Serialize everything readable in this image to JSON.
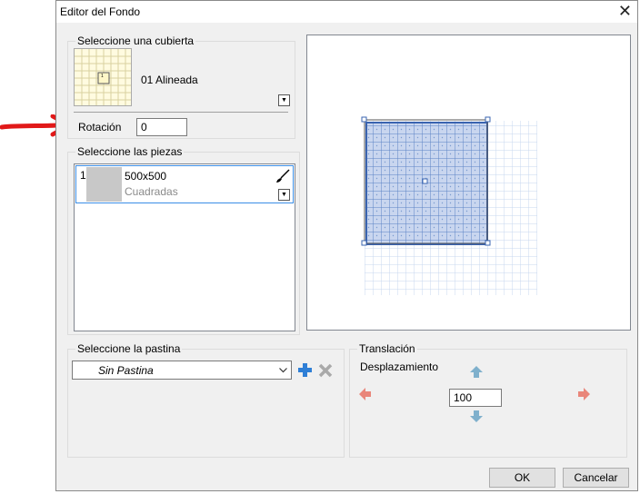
{
  "window": {
    "title": "Editor del Fondo",
    "close_glyph": "✕"
  },
  "cubierta": {
    "group_label": "Seleccione una cubierta",
    "selected_name": "01 Alineada",
    "thumb_marker": "1",
    "rotation_label": "Rotación",
    "rotation_value": "0"
  },
  "piezas": {
    "group_label": "Seleccione las piezas",
    "items": [
      {
        "index": "1",
        "size": "500x500",
        "type": "Cuadradas"
      }
    ]
  },
  "pastina": {
    "group_label": "Seleccione la pastina",
    "selected": "Sin Pastina",
    "add_icon": "plus-icon",
    "delete_icon": "x-icon"
  },
  "traslacion": {
    "group_label": "Translación",
    "displacement_label": "Desplazamiento",
    "displacement_value": "100"
  },
  "buttons": {
    "ok": "OK",
    "cancel": "Cancelar"
  },
  "colors": {
    "annotation_arrow": "#e11919",
    "selection": "#4a78c8",
    "tile_fill": "#c9d6ef",
    "arrow_green": "#7fb0cc",
    "arrow_red": "#e9867a",
    "plus_blue": "#2f7fd6"
  }
}
